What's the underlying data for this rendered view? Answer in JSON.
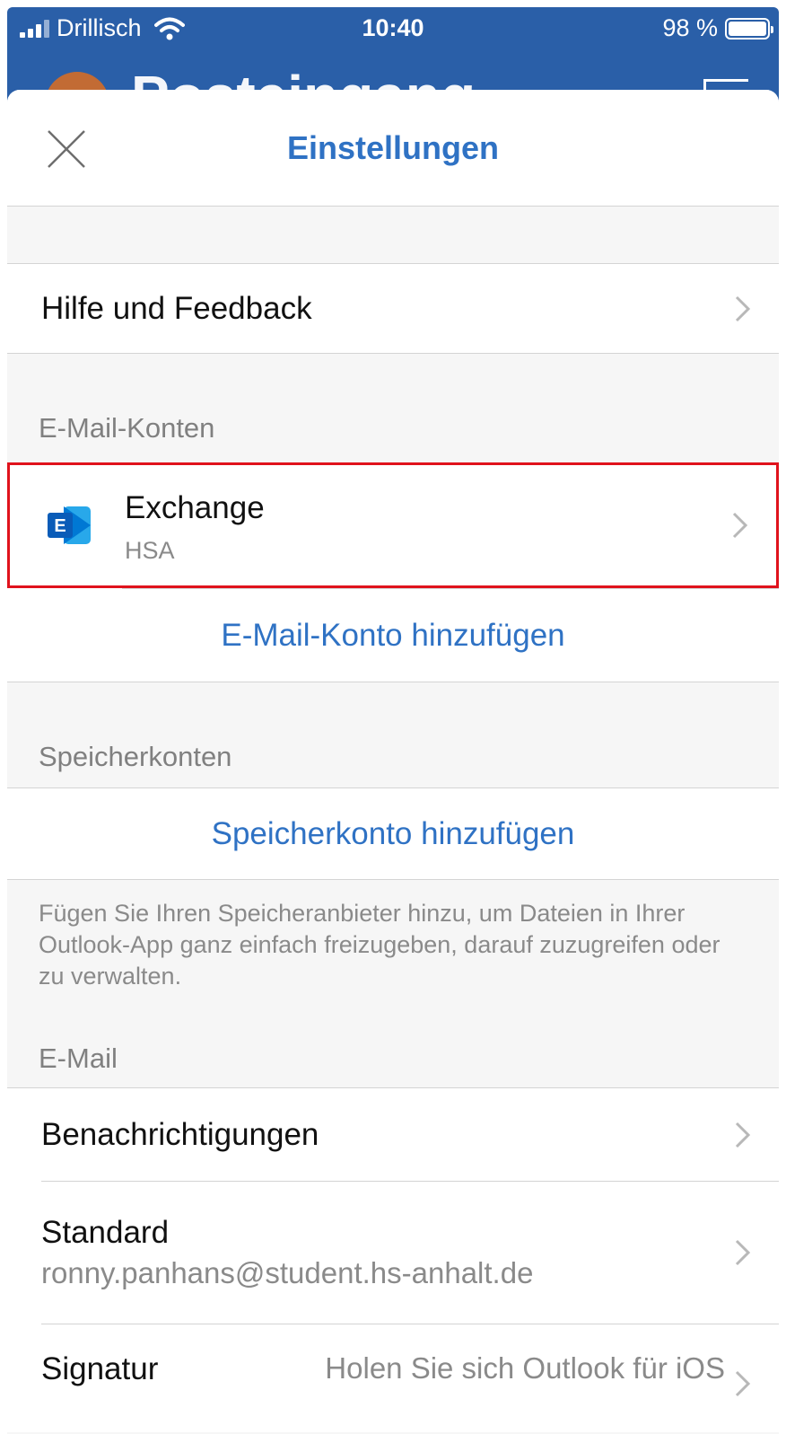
{
  "status_bar": {
    "carrier": "Drillisch",
    "time": "10:40",
    "battery": "98 %"
  },
  "background_header": {
    "title": "Posteingang"
  },
  "sheet": {
    "title": "Einstellungen"
  },
  "help": {
    "label": "Hilfe und Feedback"
  },
  "email_accounts": {
    "section_label": "E-Mail-Konten",
    "account": {
      "name": "Exchange",
      "subtitle": "HSA",
      "icon": "exchange-icon"
    },
    "add_label": "E-Mail-Konto hinzufügen"
  },
  "storage_accounts": {
    "section_label": "Speicherkonten",
    "add_label": "Speicherkonto hinzufügen",
    "info": "Fügen Sie Ihren Speicheranbieter hinzu, um Dateien in Ihrer Outlook-App ganz einfach freizugeben, darauf zuzugreifen oder zu verwalten."
  },
  "email": {
    "section_label": "E-Mail",
    "notifications_label": "Benachrichtigungen",
    "standard_label": "Standard",
    "standard_value": "ronny.panhans@student.hs-anhalt.de",
    "signature_label": "Signatur",
    "signature_value": "Holen Sie sich Outlook für iOS"
  },
  "colors": {
    "accent": "#2f72c4",
    "header_blue": "#2a5fa8",
    "highlight_red": "#e0121c"
  }
}
